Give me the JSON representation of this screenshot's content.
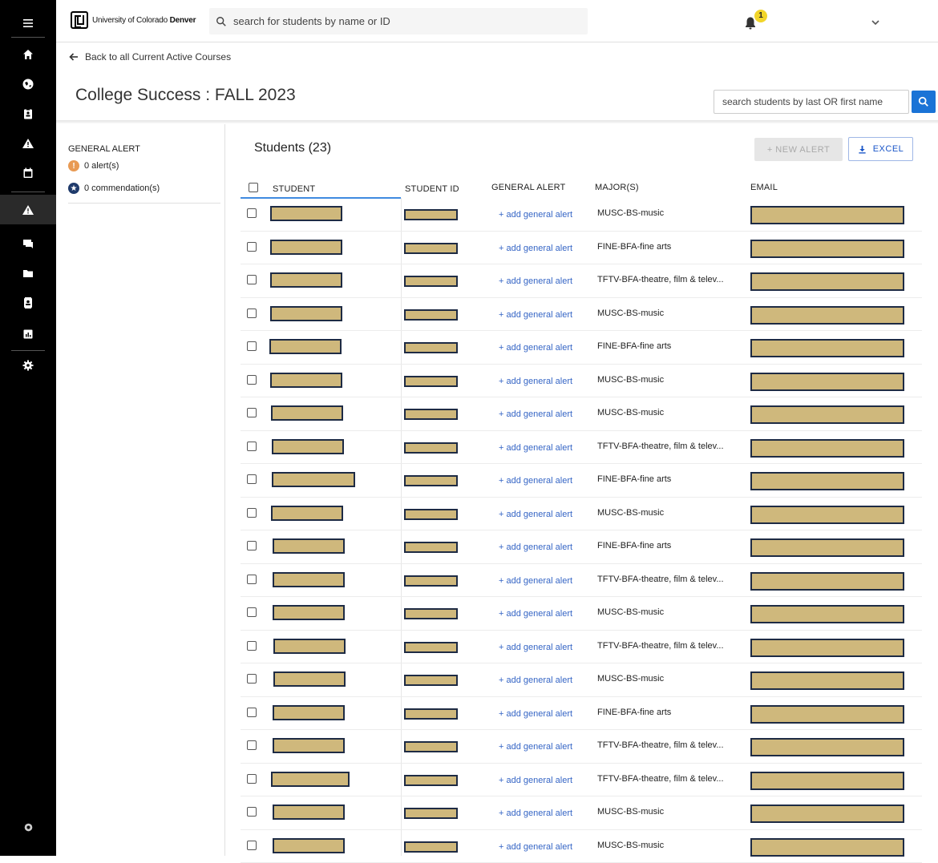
{
  "topbar": {
    "logo_text": "University of Colorado",
    "logo_bold": "Denver",
    "search_placeholder": "search for students by name or ID",
    "notification_count": "1"
  },
  "back_link": "Back to all Current Active Courses",
  "page_title": "College Success : FALL 2023",
  "name_search_placeholder": "search students by last OR first name",
  "left_panel": {
    "title": "GENERAL ALERT",
    "alerts": "0 alert(s)",
    "commendations": "0 commendation(s)"
  },
  "main": {
    "students_title": "Students (23)",
    "new_alert_label": "+  NEW ALERT",
    "excel_label": "EXCEL",
    "columns": {
      "student": "STUDENT",
      "student_id": "STUDENT ID",
      "general_alert": "GENERAL ALERT",
      "majors": "MAJOR(S)",
      "email": "EMAIL"
    },
    "add_alert_label": "+ add general alert",
    "rows": [
      {
        "major": "MUSC-BS-music"
      },
      {
        "major": "FINE-BFA-fine arts"
      },
      {
        "major": "TFTV-BFA-theatre, film & telev..."
      },
      {
        "major": "MUSC-BS-music"
      },
      {
        "major": "FINE-BFA-fine arts"
      },
      {
        "major": "MUSC-BS-music"
      },
      {
        "major": "MUSC-BS-music"
      },
      {
        "major": "TFTV-BFA-theatre, film & telev..."
      },
      {
        "major": "FINE-BFA-fine arts"
      },
      {
        "major": "MUSC-BS-music"
      },
      {
        "major": "FINE-BFA-fine arts"
      },
      {
        "major": "TFTV-BFA-theatre, film & telev..."
      },
      {
        "major": "MUSC-BS-music"
      },
      {
        "major": "TFTV-BFA-theatre, film & telev..."
      },
      {
        "major": "MUSC-BS-music"
      },
      {
        "major": "FINE-BFA-fine arts"
      },
      {
        "major": "TFTV-BFA-theatre, film & telev..."
      },
      {
        "major": "TFTV-BFA-theatre, film & telev..."
      },
      {
        "major": "MUSC-BS-music"
      },
      {
        "major": "MUSC-BS-music"
      }
    ]
  },
  "colors": {
    "redaction_fill": "#cfb87c",
    "redaction_border": "#1e2b44",
    "accent_blue": "#1a73d6",
    "rail_bg": "#000000"
  }
}
